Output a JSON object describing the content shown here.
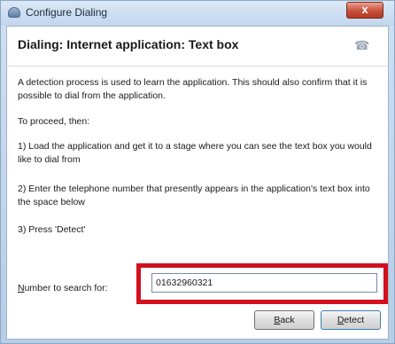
{
  "window": {
    "title": "Configure Dialing",
    "close_glyph": "x"
  },
  "header": {
    "title": "Dialing: Internet application: Text box",
    "icon": "phone-icon"
  },
  "body": {
    "intro": "A detection process is used to learn the application. This should also confirm that it is possible to dial from the application.",
    "proceed": "To proceed, then:",
    "step1": "1) Load the application and get it to a stage where you can see the text box you would like to dial from",
    "step2": "2) Enter the telephone number that presently appears in the application's text box into the space below",
    "step3": "3) Press 'Detect'"
  },
  "search": {
    "label_accel": "N",
    "label_rest": "umber to search for:",
    "value": "01632960321"
  },
  "buttons": {
    "back_accel": "B",
    "back_rest": "ack",
    "detect_accel": "D",
    "detect_rest": "etect"
  },
  "colors": {
    "highlight": "#d3101e",
    "close_button": "#c8503a"
  }
}
